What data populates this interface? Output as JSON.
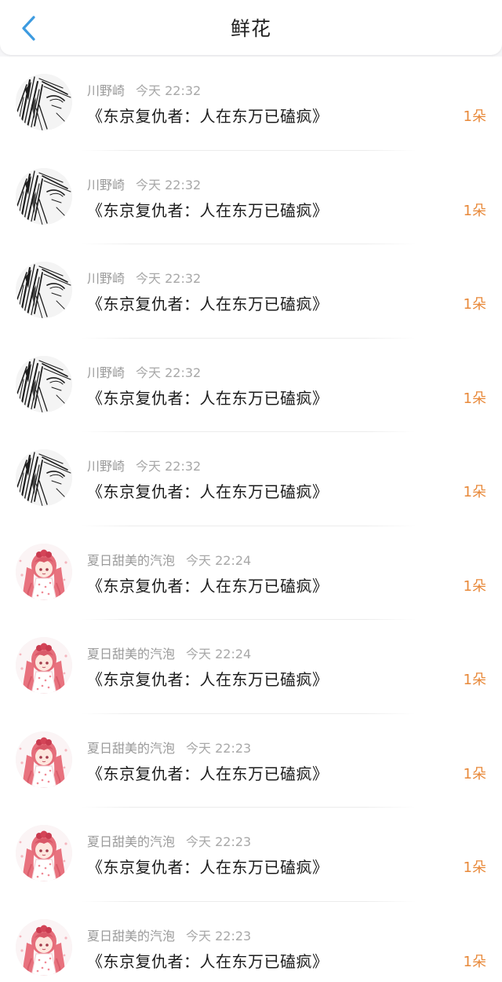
{
  "header": {
    "title": "鲜花"
  },
  "colors": {
    "accent_back": "#3d9be0",
    "count_color": "#e8893a"
  },
  "items": [
    {
      "user": "川野崎",
      "time": "今天 22:32",
      "book": "《东京复仇者：人在东万已磕疯》",
      "count": "1朵",
      "avatar": "sketch-avatar"
    },
    {
      "user": "川野崎",
      "time": "今天 22:32",
      "book": "《东京复仇者：人在东万已磕疯》",
      "count": "1朵",
      "avatar": "sketch-avatar"
    },
    {
      "user": "川野崎",
      "time": "今天 22:32",
      "book": "《东京复仇者：人在东万已磕疯》",
      "count": "1朵",
      "avatar": "sketch-avatar"
    },
    {
      "user": "川野崎",
      "time": "今天 22:32",
      "book": "《东京复仇者：人在东万已磕疯》",
      "count": "1朵",
      "avatar": "sketch-avatar"
    },
    {
      "user": "川野崎",
      "time": "今天 22:32",
      "book": "《东京复仇者：人在东万已磕疯》",
      "count": "1朵",
      "avatar": "sketch-avatar"
    },
    {
      "user": "夏日甜美的汽泡",
      "time": "今天 22:24",
      "book": "《东京复仇者：人在东万已磕疯》",
      "count": "1朵",
      "avatar": "anime-girl-avatar"
    },
    {
      "user": "夏日甜美的汽泡",
      "time": "今天 22:24",
      "book": "《东京复仇者：人在东万已磕疯》",
      "count": "1朵",
      "avatar": "anime-girl-avatar"
    },
    {
      "user": "夏日甜美的汽泡",
      "time": "今天 22:23",
      "book": "《东京复仇者：人在东万已磕疯》",
      "count": "1朵",
      "avatar": "anime-girl-avatar"
    },
    {
      "user": "夏日甜美的汽泡",
      "time": "今天 22:23",
      "book": "《东京复仇者：人在东万已磕疯》",
      "count": "1朵",
      "avatar": "anime-girl-avatar"
    },
    {
      "user": "夏日甜美的汽泡",
      "time": "今天 22:23",
      "book": "《东京复仇者：人在东万已磕疯》",
      "count": "1朵",
      "avatar": "anime-girl-avatar"
    }
  ]
}
